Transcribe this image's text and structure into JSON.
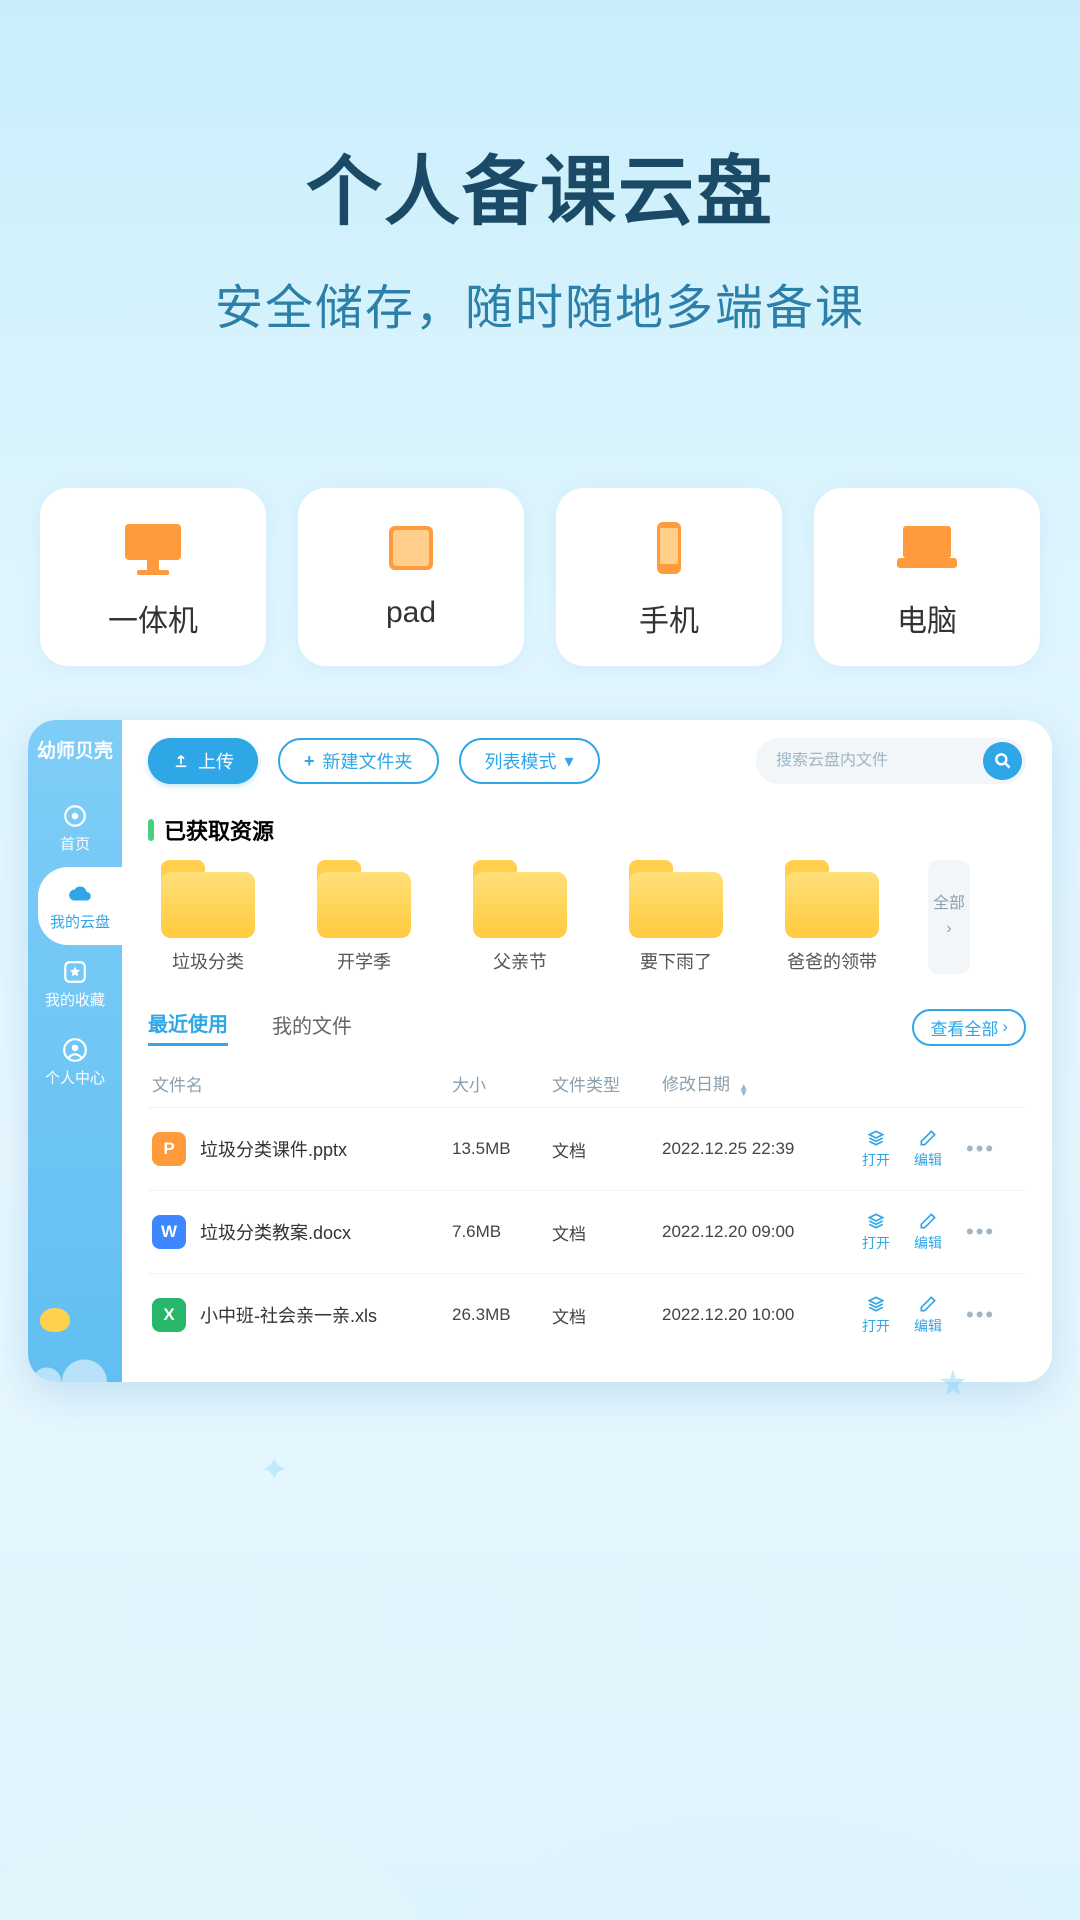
{
  "hero": {
    "title": "个人备课云盘",
    "subtitle": "安全储存，随时随地多端备课"
  },
  "devices": [
    {
      "name": "desktop",
      "label": "一体机"
    },
    {
      "name": "pad",
      "label": "pad"
    },
    {
      "name": "phone",
      "label": "手机"
    },
    {
      "name": "laptop",
      "label": "电脑"
    }
  ],
  "app": {
    "brand": "幼师贝壳",
    "nav": [
      {
        "key": "home",
        "label": "首页"
      },
      {
        "key": "cloud",
        "label": "我的云盘",
        "active": true
      },
      {
        "key": "favorite",
        "label": "我的收藏"
      },
      {
        "key": "profile",
        "label": "个人中心"
      }
    ],
    "toolbar": {
      "upload_label": "上传",
      "new_folder_label": "新建文件夹",
      "view_mode_label": "列表模式",
      "search_placeholder": "搜索云盘内文件"
    },
    "resources": {
      "heading": "已获取资源",
      "more_label": "全部",
      "folders": [
        {
          "label": "垃圾分类"
        },
        {
          "label": "开学季"
        },
        {
          "label": "父亲节"
        },
        {
          "label": "要下雨了"
        },
        {
          "label": "爸爸的领带"
        }
      ]
    },
    "tabs": {
      "recent": "最近使用",
      "mine": "我的文件",
      "view_all": "查看全部"
    },
    "table": {
      "columns": {
        "name": "文件名",
        "size": "大小",
        "type": "文件类型",
        "modified": "修改日期"
      },
      "actions": {
        "open": "打开",
        "edit": "编辑"
      },
      "rows": [
        {
          "icon": "pptx",
          "letter": "P",
          "name": "垃圾分类课件.pptx",
          "size": "13.5MB",
          "type": "文档",
          "modified": "2022.12.25 22:39"
        },
        {
          "icon": "docx",
          "letter": "W",
          "name": "垃圾分类教案.docx",
          "size": "7.6MB",
          "type": "文档",
          "modified": "2022.12.20 09:00"
        },
        {
          "icon": "xls",
          "letter": "X",
          "name": "小中班-社会亲一亲.xls",
          "size": "26.3MB",
          "type": "文档",
          "modified": "2022.12.20 10:00"
        }
      ]
    }
  }
}
